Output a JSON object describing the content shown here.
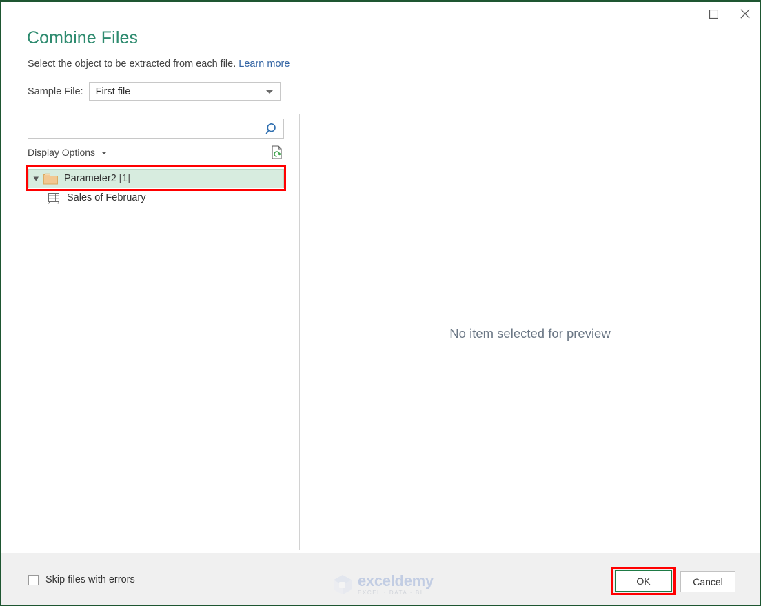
{
  "window": {
    "maximize_icon": "maximize-icon",
    "close_icon": "close-icon"
  },
  "header": {
    "title": "Combine Files",
    "subtitle": "Select the object to be extracted from each file.",
    "learn_more": "Learn more",
    "sample_file_label": "Sample File:",
    "sample_file_value": "First file"
  },
  "left_pane": {
    "search_placeholder": "",
    "search_value": "",
    "search_icon": "search-icon",
    "display_options_label": "Display Options",
    "refresh_icon": "refresh-page-icon",
    "tree": [
      {
        "label": "Parameter2",
        "count": "[1]",
        "icon": "folder-icon",
        "expanded": true,
        "selected": true,
        "level": 0
      },
      {
        "label": "Sales of February",
        "count": "",
        "icon": "table-icon",
        "expanded": false,
        "selected": false,
        "level": 1
      }
    ]
  },
  "right_pane": {
    "empty_message": "No item selected for preview"
  },
  "footer": {
    "skip_label": "Skip files with errors",
    "skip_checked": false,
    "ok_label": "OK",
    "cancel_label": "Cancel"
  },
  "watermark": {
    "name": "exceldemy",
    "tagline": "EXCEL · DATA · BI"
  },
  "colors": {
    "title_green": "#2e8b6f",
    "link_blue": "#3465a4",
    "selection_green": "#d7ecdf",
    "annotation_red": "#ff0000",
    "footer_gray": "#f0f0f0"
  }
}
